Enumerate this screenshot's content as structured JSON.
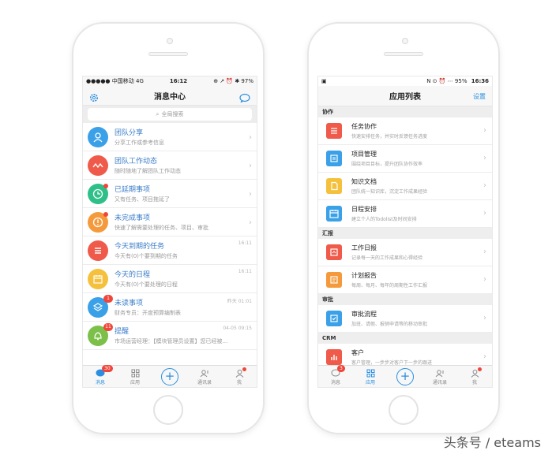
{
  "left_phone": {
    "status": {
      "carrier": "●●●●● 中国移动  4G",
      "time": "16:12",
      "right": "⊕ ↗ ⏰ ✱ 97%"
    },
    "title": "消息中心",
    "search_placeholder": "全局搜索",
    "messages": [
      {
        "title": "团队分享",
        "sub": "分享工作或参考信息",
        "time": "",
        "color": "#3aa0e8",
        "icon": "person-icon"
      },
      {
        "title": "团队工作动态",
        "sub": "随时随地了解团队工作动态",
        "time": "",
        "color": "#ef5a4a",
        "icon": "wave-icon"
      },
      {
        "title": "已延期事项",
        "sub": "又有任务、项目拖延了",
        "time": "",
        "color": "#2fc08a",
        "icon": "clock-icon"
      },
      {
        "title": "未完成事项",
        "sub": "快速了解需要处理的任务、项目、审批",
        "time": "",
        "color": "#f59a3c",
        "icon": "alert-icon"
      },
      {
        "title": "今天到期的任务",
        "sub": "今天有(0)个要到期的任务",
        "time": "16:11",
        "color": "#ef5a4a",
        "icon": "list-icon"
      },
      {
        "title": "今天的日程",
        "sub": "今天有(0)个要处理的日程",
        "time": "16:11",
        "color": "#f5c13c",
        "icon": "calendar-icon"
      },
      {
        "title": "未读事项",
        "sub": "财务专员：开度预算编制表",
        "time": "昨天 01:01",
        "color": "#3aa0e8",
        "icon": "layers-icon",
        "badge": "1"
      },
      {
        "title": "提醒",
        "sub": "市场运营经理：【模块管理员设置】您已经被...",
        "time": "04-05 09:15",
        "color": "#7cc04a",
        "icon": "bell-icon",
        "badge": "11"
      }
    ],
    "tabs": [
      {
        "label": "消息",
        "badge": "30",
        "icon": "chat-icon"
      },
      {
        "label": "应用",
        "icon": "grid-icon"
      },
      {
        "label": "",
        "icon": "plus-icon"
      },
      {
        "label": "通讯录",
        "icon": "contacts-icon"
      },
      {
        "label": "我",
        "icon": "me-icon"
      }
    ]
  },
  "right_phone": {
    "status": {
      "left": "▣",
      "right": "N ⊙ ⏰ ⋯ 95%",
      "time": "16:36"
    },
    "title": "应用列表",
    "settings": "设置",
    "sections": [
      {
        "name": "协作",
        "items": [
          {
            "title": "任务协作",
            "sub": "快速安排任务，并实时反馈任务进度",
            "color": "#ef5a4a",
            "icon": "task-icon"
          },
          {
            "title": "项目管理",
            "sub": "围绕项目目标，提升团队协作效率",
            "color": "#3aa0e8",
            "icon": "project-icon"
          },
          {
            "title": "知识文档",
            "sub": "团队统一知识库，沉淀工作成果经验",
            "color": "#f5c13c",
            "icon": "document-icon"
          },
          {
            "title": "日程安排",
            "sub": "建立个人的Todolist及时间安排",
            "color": "#3aa0e8",
            "icon": "calendar-icon"
          }
        ]
      },
      {
        "name": "汇报",
        "items": [
          {
            "title": "工作日报",
            "sub": "记录每一天的工作成果和心得经验",
            "color": "#ef5a4a",
            "icon": "daily-report-icon"
          },
          {
            "title": "计划报告",
            "sub": "每周、每月、每年的周期性工作汇报",
            "color": "#f59a3c",
            "icon": "plan-report-icon"
          }
        ]
      },
      {
        "name": "审批",
        "items": [
          {
            "title": "审批流程",
            "sub": "加班、请假、报销申请等的移动审批",
            "color": "#3aa0e8",
            "icon": "approval-icon"
          }
        ]
      },
      {
        "name": "CRM",
        "items": [
          {
            "title": "客户",
            "sub": "客户管理，一步步对客户下一步的跟进",
            "color": "#ef5a4a",
            "icon": "customer-icon"
          }
        ]
      }
    ],
    "tabs": [
      {
        "label": "消息",
        "badge": "3",
        "icon": "chat-icon"
      },
      {
        "label": "应用",
        "icon": "grid-icon"
      },
      {
        "label": "",
        "icon": "plus-icon"
      },
      {
        "label": "通讯录",
        "icon": "contacts-icon"
      },
      {
        "label": "我",
        "icon": "me-icon"
      }
    ]
  },
  "watermark": "头条号 / eteams",
  "colors": {
    "accent": "#2a8fe0",
    "alert": "#f0453a"
  }
}
